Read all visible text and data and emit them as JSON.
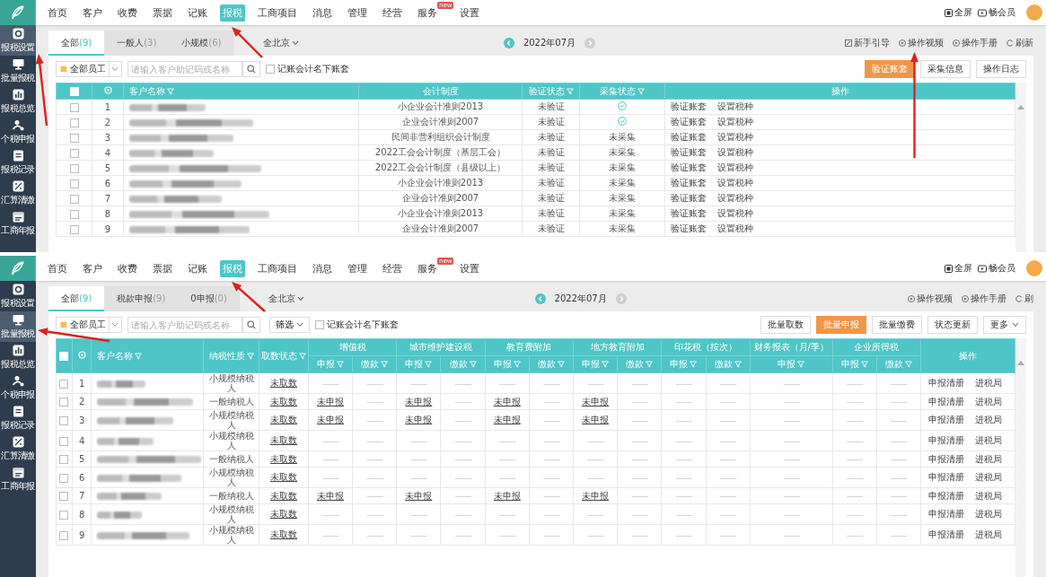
{
  "top_screen": {
    "sidebar": [
      {
        "label": "报税设置",
        "selected": true
      },
      {
        "label": "批量报税",
        "selected": false
      },
      {
        "label": "报税总览",
        "selected": false
      },
      {
        "label": "个税申报",
        "selected": false
      },
      {
        "label": "报税记录",
        "selected": false
      },
      {
        "label": "汇算清缴",
        "selected": false
      },
      {
        "label": "工商年报",
        "selected": false
      }
    ],
    "nav": [
      {
        "label": "首页",
        "selected": false
      },
      {
        "label": "客户",
        "selected": false
      },
      {
        "label": "收费",
        "selected": false
      },
      {
        "label": "票据",
        "selected": false
      },
      {
        "label": "记账",
        "selected": false
      },
      {
        "label": "报税",
        "selected": true
      },
      {
        "label": "工商项目",
        "selected": false
      },
      {
        "label": "消息",
        "selected": false
      },
      {
        "label": "管理",
        "selected": false
      },
      {
        "label": "经营",
        "selected": false
      },
      {
        "label": "服务",
        "selected": false,
        "badge": "new"
      },
      {
        "label": "设置",
        "selected": false
      }
    ],
    "header_actions": [
      "全屏",
      "畅会员"
    ],
    "tabs": [
      {
        "label": "全部",
        "count": "(9)",
        "selected": true
      },
      {
        "label": "一般人",
        "count": "(3)",
        "selected": false
      },
      {
        "label": "小规模",
        "count": "(6)",
        "selected": false
      }
    ],
    "region": "全北京",
    "period": {
      "label": "2022年07月",
      "next_disabled": true
    },
    "links": [
      {
        "label": "新手引导",
        "kind": "guide"
      },
      {
        "label": "操作视频",
        "kind": "video"
      },
      {
        "label": "操作手册",
        "kind": "manual"
      },
      {
        "label": "刷新",
        "kind": "refresh"
      }
    ],
    "staff_select": "全部员工",
    "search_placeholder": "请输入客户助记码或名称",
    "checkbox": {
      "label": "记账会计名下账套",
      "checked": false
    },
    "buttons": [
      {
        "label": "验证账套",
        "primary": true
      },
      {
        "label": "采集信息",
        "primary": false
      },
      {
        "label": "操作日志",
        "primary": false
      }
    ],
    "table": {
      "select_all_checked": false,
      "columns": [
        {
          "label": "客户名称",
          "filter": true
        },
        {
          "label": "会计制度",
          "filter": false
        },
        {
          "label": "验证状态",
          "filter": true
        },
        {
          "label": "采集状态",
          "filter": true
        },
        {
          "label": "操作",
          "filter": false
        }
      ],
      "rows": [
        {
          "no": "1",
          "checked": false,
          "system": "小企业会计准则2013",
          "verify": "未验证",
          "collected": true,
          "ops": [
            "验证账套",
            "设置税种"
          ]
        },
        {
          "no": "2",
          "checked": false,
          "system": "企业会计准则2007",
          "verify": "未验证",
          "collected": true,
          "ops": [
            "验证账套",
            "设置税种"
          ]
        },
        {
          "no": "3",
          "checked": false,
          "system": "民间非营利组织会计制度",
          "verify": "未验证",
          "collected": false,
          "collect_text": "未采集",
          "ops": [
            "验证账套",
            "设置税种"
          ]
        },
        {
          "no": "4",
          "checked": false,
          "system": "2022工会会计制度（基层工会）",
          "verify": "未验证",
          "collected": false,
          "collect_text": "未采集",
          "ops": [
            "验证账套",
            "设置税种"
          ]
        },
        {
          "no": "5",
          "checked": false,
          "system": "2022工会会计制度（县级以上）",
          "verify": "未验证",
          "collected": false,
          "collect_text": "未采集",
          "ops": [
            "验证账套",
            "设置税种"
          ]
        },
        {
          "no": "6",
          "checked": false,
          "system": "小企业会计准则2013",
          "verify": "未验证",
          "collected": false,
          "collect_text": "未采集",
          "ops": [
            "验证账套",
            "设置税种"
          ]
        },
        {
          "no": "7",
          "checked": false,
          "system": "企业会计准则2007",
          "verify": "未验证",
          "collected": false,
          "collect_text": "未采集",
          "ops": [
            "验证账套",
            "设置税种"
          ]
        },
        {
          "no": "8",
          "checked": false,
          "system": "小企业会计准则2013",
          "verify": "未验证",
          "collected": false,
          "collect_text": "未采集",
          "ops": [
            "验证账套",
            "设置税种"
          ]
        },
        {
          "no": "9",
          "checked": false,
          "system": "企业会计准则2007",
          "verify": "未验证",
          "collected": false,
          "collect_text": "未采集",
          "ops": [
            "验证账套",
            "设置税种"
          ]
        }
      ]
    }
  },
  "bottom_screen": {
    "sidebar": [
      {
        "label": "报税设置",
        "selected": false
      },
      {
        "label": "批量报税",
        "selected": true
      },
      {
        "label": "报税总览",
        "selected": false
      },
      {
        "label": "个税申报",
        "selected": false
      },
      {
        "label": "报税记录",
        "selected": false
      },
      {
        "label": "汇算清缴",
        "selected": false
      },
      {
        "label": "工商年报",
        "selected": false
      }
    ],
    "nav": [
      {
        "label": "首页",
        "selected": false
      },
      {
        "label": "客户",
        "selected": false
      },
      {
        "label": "收费",
        "selected": false
      },
      {
        "label": "票据",
        "selected": false
      },
      {
        "label": "记账",
        "selected": false
      },
      {
        "label": "报税",
        "selected": true
      },
      {
        "label": "工商项目",
        "selected": false
      },
      {
        "label": "消息",
        "selected": false
      },
      {
        "label": "管理",
        "selected": false
      },
      {
        "label": "经营",
        "selected": false
      },
      {
        "label": "服务",
        "selected": false,
        "badge": "new"
      },
      {
        "label": "设置",
        "selected": false
      }
    ],
    "header_actions": [
      "全屏",
      "畅会员"
    ],
    "tabs": [
      {
        "label": "全部",
        "count": "(9)",
        "selected": true
      },
      {
        "label": "税款申报",
        "count": "(9)",
        "selected": false
      },
      {
        "label": "0申报",
        "count": "(0)",
        "selected": false
      }
    ],
    "region": "全北京",
    "period": {
      "label": "2022年07月",
      "next_disabled": true
    },
    "links": [
      {
        "label": "操作视频",
        "kind": "video"
      },
      {
        "label": "操作手册",
        "kind": "manual"
      },
      {
        "label": "刷",
        "kind": "refresh"
      }
    ],
    "staff_select": "全部员工",
    "search_placeholder": "请输入客户助记码或名称",
    "filter_button": "筛选",
    "checkbox": {
      "label": "记账会计名下账套",
      "checked": false
    },
    "buttons": [
      {
        "label": "批量取数",
        "primary": false
      },
      {
        "label": "批量申报",
        "primary": true
      },
      {
        "label": "批量缴费",
        "primary": false
      },
      {
        "label": "状态更新",
        "primary": false
      },
      {
        "label": "更多",
        "primary": false,
        "caret": true
      }
    ],
    "table": {
      "select_all_checked": false,
      "columns": [
        {
          "label": "客户名称",
          "filter": true
        },
        {
          "label": "纳税性质",
          "filter": true
        },
        {
          "label": "取数状态",
          "filter": true
        }
      ],
      "groups": [
        {
          "label": "增值税",
          "subs": [
            {
              "label": "申报",
              "filter": true
            },
            {
              "label": "缴款",
              "filter": true
            }
          ]
        },
        {
          "label": "城市维护建设税",
          "subs": [
            {
              "label": "申报",
              "filter": true
            },
            {
              "label": "缴款",
              "filter": true
            }
          ]
        },
        {
          "label": "教育费附加",
          "subs": [
            {
              "label": "申报",
              "filter": true
            },
            {
              "label": "缴款",
              "filter": true
            }
          ]
        },
        {
          "label": "地方教育附加",
          "subs": [
            {
              "label": "申报",
              "filter": true
            },
            {
              "label": "缴款",
              "filter": true
            }
          ]
        },
        {
          "label": "印花税（按次）",
          "subs": [
            {
              "label": "申报",
              "filter": true
            },
            {
              "label": "缴款",
              "filter": true
            }
          ]
        },
        {
          "label": "财务报表（月/季）",
          "subs": [
            {
              "label": "申报",
              "filter": true
            }
          ]
        },
        {
          "label": "企业所得税",
          "subs": [
            {
              "label": "申报",
              "filter": true
            },
            {
              "label": "缴款",
              "filter": true
            }
          ]
        }
      ],
      "ops_label": "操作",
      "rows": [
        {
          "no": "1",
          "checked": false,
          "nature": "小规模纳税人",
          "fetch": "未取数",
          "cells": [
            {
              "text": "——",
              "link": false
            },
            {
              "text": "——",
              "link": false
            },
            {
              "text": "——",
              "link": false
            },
            {
              "text": "——",
              "link": false
            },
            {
              "text": "——",
              "link": false
            },
            {
              "text": "——",
              "link": false
            },
            {
              "text": "——",
              "link": false
            },
            {
              "text": "——",
              "link": false
            },
            {
              "text": "——",
              "link": false
            },
            {
              "text": "——",
              "link": false
            },
            {
              "text": "——",
              "link": false
            },
            {
              "text": "——",
              "link": false
            },
            {
              "text": "——",
              "link": false
            }
          ],
          "ops": [
            "申报清册",
            "进税局"
          ]
        },
        {
          "no": "2",
          "checked": false,
          "nature": "一般纳税人",
          "fetch": "未取数",
          "cells": [
            {
              "text": "未申报",
              "link": true
            },
            {
              "text": "——",
              "link": false
            },
            {
              "text": "未申报",
              "link": true
            },
            {
              "text": "——",
              "link": false
            },
            {
              "text": "未申报",
              "link": true
            },
            {
              "text": "——",
              "link": false
            },
            {
              "text": "未申报",
              "link": true
            },
            {
              "text": "——",
              "link": false
            },
            {
              "text": "——",
              "link": false
            },
            {
              "text": "——",
              "link": false
            },
            {
              "text": "——",
              "link": false
            },
            {
              "text": "——",
              "link": false
            },
            {
              "text": "——",
              "link": false
            }
          ],
          "ops": [
            "申报清册",
            "进税局"
          ]
        },
        {
          "no": "3",
          "checked": false,
          "nature": "小规模纳税人",
          "fetch": "未取数",
          "cells": [
            {
              "text": "未申报",
              "link": true
            },
            {
              "text": "——",
              "link": false
            },
            {
              "text": "未申报",
              "link": true
            },
            {
              "text": "——",
              "link": false
            },
            {
              "text": "未申报",
              "link": true
            },
            {
              "text": "——",
              "link": false
            },
            {
              "text": "未申报",
              "link": true
            },
            {
              "text": "——",
              "link": false
            },
            {
              "text": "——",
              "link": false
            },
            {
              "text": "——",
              "link": false
            },
            {
              "text": "——",
              "link": false
            },
            {
              "text": "——",
              "link": false
            },
            {
              "text": "——",
              "link": false
            }
          ],
          "ops": [
            "申报清册",
            "进税局"
          ]
        },
        {
          "no": "4",
          "checked": false,
          "nature": "小规模纳税人",
          "fetch": "未取数",
          "cells": [
            {
              "text": "——",
              "link": false
            },
            {
              "text": "——",
              "link": false
            },
            {
              "text": "——",
              "link": false
            },
            {
              "text": "——",
              "link": false
            },
            {
              "text": "——",
              "link": false
            },
            {
              "text": "——",
              "link": false
            },
            {
              "text": "——",
              "link": false
            },
            {
              "text": "——",
              "link": false
            },
            {
              "text": "——",
              "link": false
            },
            {
              "text": "——",
              "link": false
            },
            {
              "text": "——",
              "link": false
            },
            {
              "text": "——",
              "link": false
            },
            {
              "text": "——",
              "link": false
            }
          ],
          "ops": [
            "申报清册",
            "进税局"
          ]
        },
        {
          "no": "5",
          "checked": false,
          "nature": "一般纳税人",
          "fetch": "未取数",
          "cells": [
            {
              "text": "——",
              "link": false
            },
            {
              "text": "——",
              "link": false
            },
            {
              "text": "——",
              "link": false
            },
            {
              "text": "——",
              "link": false
            },
            {
              "text": "——",
              "link": false
            },
            {
              "text": "——",
              "link": false
            },
            {
              "text": "——",
              "link": false
            },
            {
              "text": "——",
              "link": false
            },
            {
              "text": "——",
              "link": false
            },
            {
              "text": "——",
              "link": false
            },
            {
              "text": "——",
              "link": false
            },
            {
              "text": "——",
              "link": false
            },
            {
              "text": "——",
              "link": false
            }
          ],
          "ops": [
            "申报清册",
            "进税局"
          ]
        },
        {
          "no": "6",
          "checked": false,
          "nature": "小规模纳税人",
          "fetch": "未取数",
          "cells": [
            {
              "text": "——",
              "link": false
            },
            {
              "text": "——",
              "link": false
            },
            {
              "text": "——",
              "link": false
            },
            {
              "text": "——",
              "link": false
            },
            {
              "text": "——",
              "link": false
            },
            {
              "text": "——",
              "link": false
            },
            {
              "text": "——",
              "link": false
            },
            {
              "text": "——",
              "link": false
            },
            {
              "text": "——",
              "link": false
            },
            {
              "text": "——",
              "link": false
            },
            {
              "text": "——",
              "link": false
            },
            {
              "text": "——",
              "link": false
            },
            {
              "text": "——",
              "link": false
            }
          ],
          "ops": [
            "申报清册",
            "进税局"
          ]
        },
        {
          "no": "7",
          "checked": false,
          "nature": "一般纳税人",
          "fetch": "未取数",
          "cells": [
            {
              "text": "未申报",
              "link": true
            },
            {
              "text": "——",
              "link": false
            },
            {
              "text": "未申报",
              "link": true
            },
            {
              "text": "——",
              "link": false
            },
            {
              "text": "未申报",
              "link": true
            },
            {
              "text": "——",
              "link": false
            },
            {
              "text": "未申报",
              "link": true
            },
            {
              "text": "——",
              "link": false
            },
            {
              "text": "——",
              "link": false
            },
            {
              "text": "——",
              "link": false
            },
            {
              "text": "——",
              "link": false
            },
            {
              "text": "——",
              "link": false
            },
            {
              "text": "——",
              "link": false
            }
          ],
          "ops": [
            "申报清册",
            "进税局"
          ]
        },
        {
          "no": "8",
          "checked": false,
          "nature": "小规模纳税人",
          "fetch": "未取数",
          "cells": [
            {
              "text": "——",
              "link": false
            },
            {
              "text": "——",
              "link": false
            },
            {
              "text": "——",
              "link": false
            },
            {
              "text": "——",
              "link": false
            },
            {
              "text": "——",
              "link": false
            },
            {
              "text": "——",
              "link": false
            },
            {
              "text": "——",
              "link": false
            },
            {
              "text": "——",
              "link": false
            },
            {
              "text": "——",
              "link": false
            },
            {
              "text": "——",
              "link": false
            },
            {
              "text": "——",
              "link": false
            },
            {
              "text": "——",
              "link": false
            },
            {
              "text": "——",
              "link": false
            }
          ],
          "ops": [
            "申报清册",
            "进税局"
          ]
        },
        {
          "no": "9",
          "checked": false,
          "nature": "小规模纳税人",
          "fetch": "未取数",
          "cells": [
            {
              "text": "——",
              "link": false
            },
            {
              "text": "——",
              "link": false
            },
            {
              "text": "——",
              "link": false
            },
            {
              "text": "——",
              "link": false
            },
            {
              "text": "——",
              "link": false
            },
            {
              "text": "——",
              "link": false
            },
            {
              "text": "——",
              "link": false
            },
            {
              "text": "——",
              "link": false
            },
            {
              "text": "——",
              "link": false
            },
            {
              "text": "——",
              "link": false
            },
            {
              "text": "——",
              "link": false
            },
            {
              "text": "——",
              "link": false
            },
            {
              "text": "——",
              "link": false
            }
          ],
          "ops": [
            "申报清册",
            "进税局"
          ]
        }
      ]
    }
  }
}
